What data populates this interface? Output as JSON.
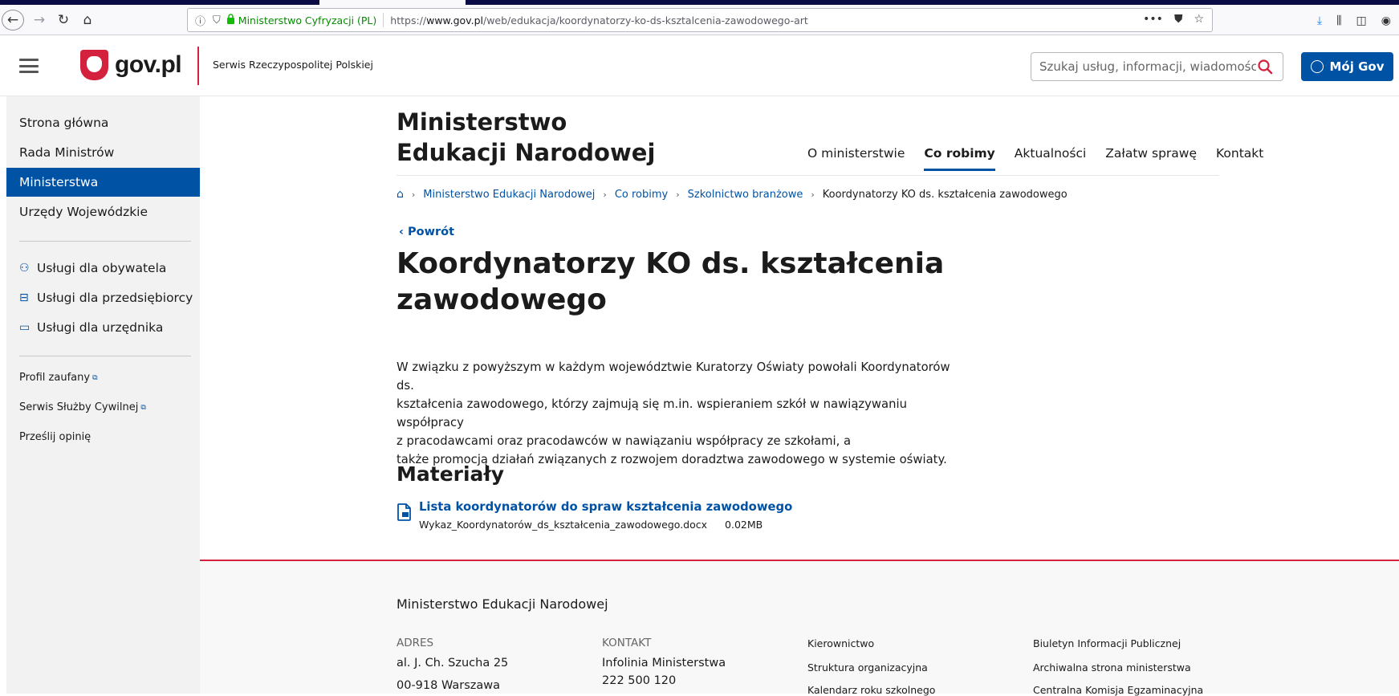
{
  "browser": {
    "site_identity": "Ministerstwo Cyfryzacji (PL)",
    "url_prefix": "https://",
    "url_domain": "www.gov.pl",
    "url_path": "/web/edukacja/koordynatorzy-ko-ds-ksztalcenia-zawodowego-art"
  },
  "header": {
    "logo_text": "gov.pl",
    "service_name": "Serwis Rzeczypospolitej Polskiej",
    "search_placeholder": "Szukaj usług, informacji, wiadomości",
    "account_label": "Mój Gov"
  },
  "sidebar": {
    "items": [
      {
        "label": "Strona główna"
      },
      {
        "label": "Rada Ministrów"
      },
      {
        "label": "Ministerstwa",
        "active": true
      },
      {
        "label": "Urzędy Wojewódzkie"
      }
    ],
    "services": [
      {
        "label": "Usługi dla obywatela",
        "icon": "person-icon"
      },
      {
        "label": "Usługi dla przedsiębiorcy",
        "icon": "briefcase-icon"
      },
      {
        "label": "Usługi dla urzędnika",
        "icon": "laptop-icon"
      }
    ],
    "links": [
      {
        "label": "Profil zaufany",
        "external": true
      },
      {
        "label": "Serwis Służby Cywilnej",
        "external": true
      },
      {
        "label": "Prześlij opinię",
        "external": false
      }
    ]
  },
  "ministry": {
    "title_line1": "Ministerstwo",
    "title_line2": "Edukacji Narodowej"
  },
  "top_nav": [
    {
      "label": "O ministerstwie"
    },
    {
      "label": "Co robimy",
      "active": true
    },
    {
      "label": "Aktualności"
    },
    {
      "label": "Załatw sprawę"
    },
    {
      "label": "Kontakt"
    }
  ],
  "breadcrumb": [
    "Ministerstwo Edukacji Narodowej",
    "Co robimy",
    "Szkolnictwo branżowe",
    "Koordynatorzy KO ds. kształcenia zawodowego"
  ],
  "article": {
    "back_label": "Powrót",
    "title": "Koordynatorzy KO ds. kształcenia zawodowego",
    "body_lines": [
      "W związku z powyższym w każdym województwie Kuratorzy Oświaty powołali Koordynatorów ds.",
      "kształcenia zawodowego, którzy zajmują się m.in. wspieraniem szkół w nawiązywaniu współpracy",
      "z pracodawcami oraz pracodawców w nawiązaniu współpracy ze szkołami, a",
      "także promocją działań związanych z rozwojem doradztwa zawodowego w systemie oświaty."
    ],
    "materials_heading": "Materiały",
    "file": {
      "title": "Lista koordynatorów do spraw kształcenia zawodowego",
      "filename": "Wykaz_Koordynatorów_ds_kształcenia_zawodowego.docx",
      "size": "0.02MB"
    }
  },
  "footer": {
    "org_name": "Ministerstwo Edukacji Narodowej",
    "address_heading": "ADRES",
    "address_lines": [
      "al. J. Ch. Szucha 25",
      "00-918 Warszawa"
    ],
    "contact_heading": "KONTAKT",
    "contact_lines": [
      "Infolinia Ministerstwa",
      "222 500 120"
    ],
    "links_col1": [
      "Kierownictwo",
      "Struktura organizacyjna",
      "Kalendarz roku szkolnego"
    ],
    "links_col2": [
      "Biuletyn Informacji Publicznej",
      "Archiwalna strona ministerstwa",
      "Centralna Komisja Egzaminacyjna"
    ]
  },
  "colors": {
    "brand_blue": "#0052a5",
    "brand_red": "#d4213d"
  }
}
